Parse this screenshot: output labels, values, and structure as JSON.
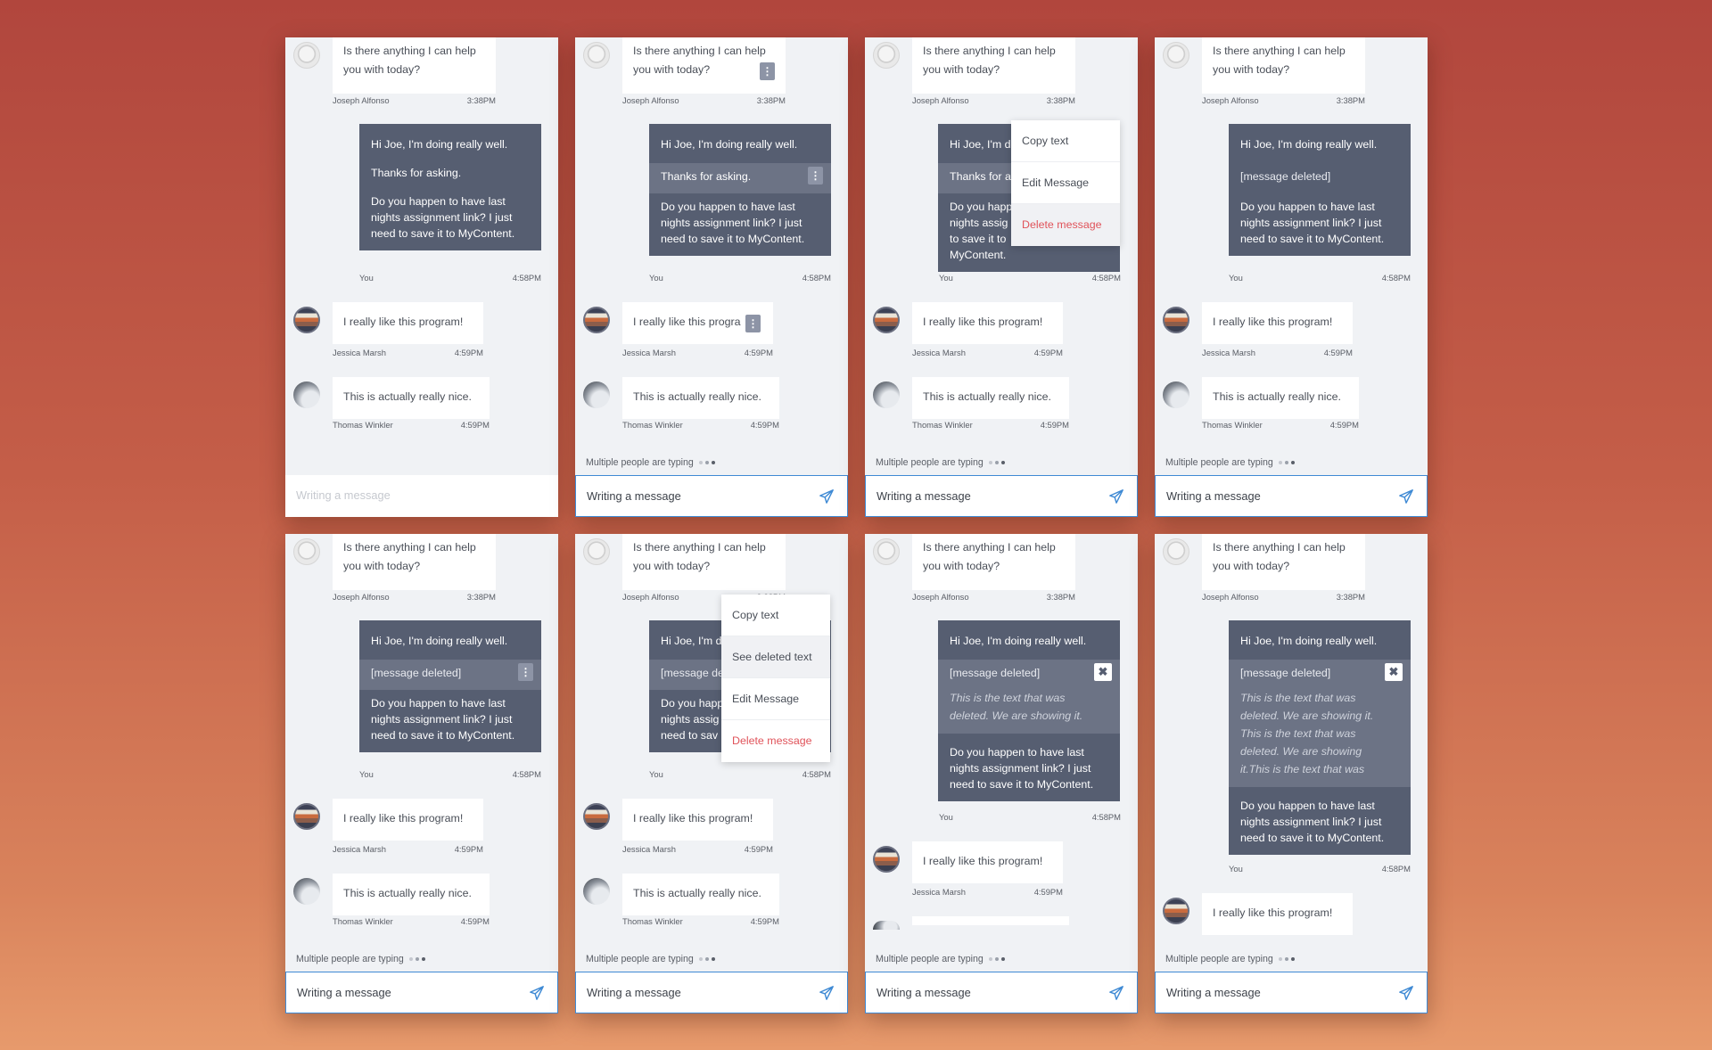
{
  "names": {
    "joseph": "Joseph Alfonso",
    "you": "You",
    "jessica": "Jessica Marsh",
    "thomas": "Thomas Winkler"
  },
  "times": {
    "t338": "3:38PM",
    "t458": "4:58PM",
    "t459": "4:59PM"
  },
  "msgs": {
    "joseph": "Is there anything I can help you with today?",
    "you_1": "Hi Joe, I'm doing really well.",
    "you_2": "Thanks for asking.",
    "you_2_short": "Thanks for a",
    "you_1_short": "Hi Joe, I'm d",
    "you_3": "Do you happen to have last nights assignment link? I just need to save it to MyContent.",
    "you_3_short": "Do you happ nights assig need to save it to MyContent.",
    "you_3_short_b": "Do you happ nights assig need to sav",
    "deleted": "[message deleted]",
    "deleted_short": "[message de",
    "deleted_text_1": "This is the text that was deleted. We are showing it.",
    "deleted_text_2": "This is the text that was deleted. We are showing it. This is the text that was deleted. We are showing it.This is the text that was",
    "jessica": "I really like this program!",
    "jessica_short": "I really like this progra",
    "thomas": "This is actually really nice."
  },
  "typing": "Multiple people are typing",
  "input_placeholder": "Writing a message",
  "menu": {
    "copy": "Copy text",
    "see_deleted": "See deleted text",
    "edit": "Edit Message",
    "delete": "Delete message"
  },
  "icons": {
    "more": "more-vertical-icon",
    "send": "send-icon",
    "close": "close-icon"
  },
  "colors": {
    "accent": "#3f8ad4",
    "danger": "#e0535a",
    "own_bubble": "#565e71"
  }
}
